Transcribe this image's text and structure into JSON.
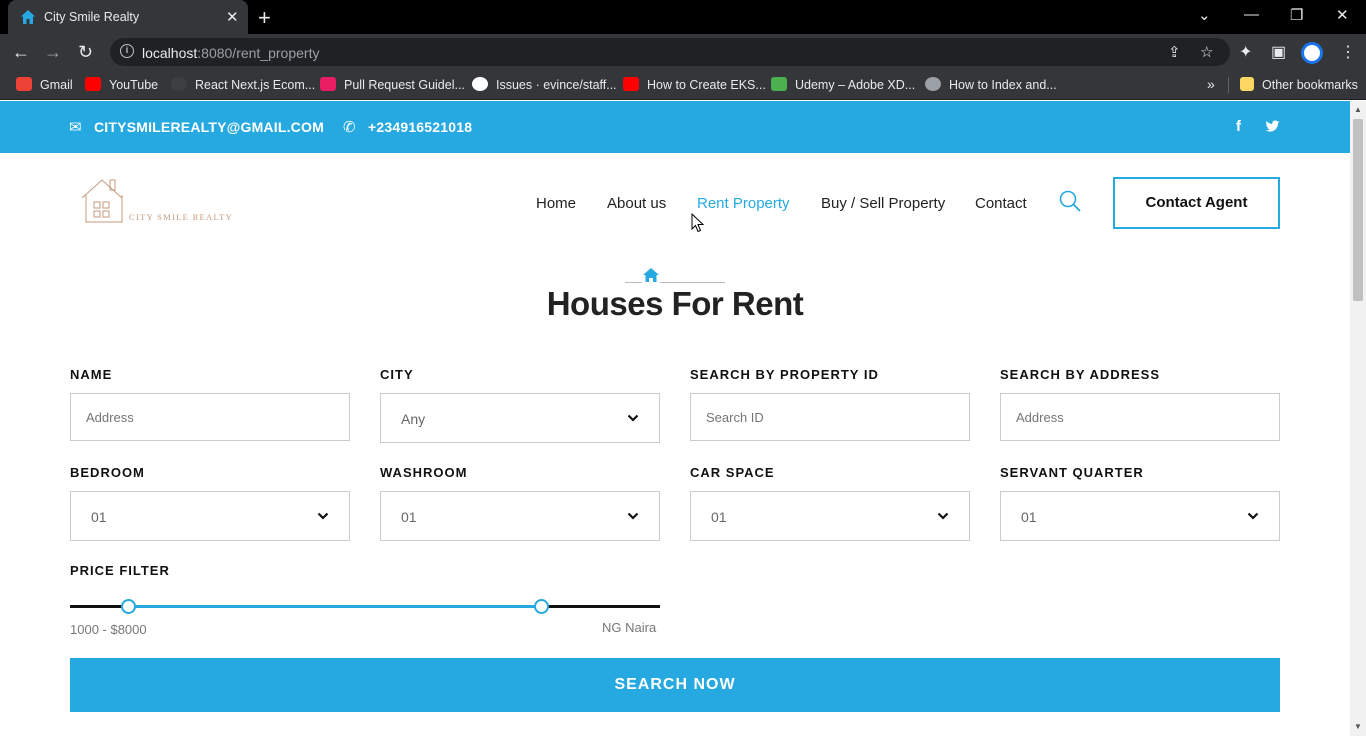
{
  "browser": {
    "tab_title": "City Smile Realty",
    "url_host": "localhost",
    "url_rest": ":8080/rent_property",
    "bookmarks": [
      {
        "label": "Gmail",
        "color": "#ea4335"
      },
      {
        "label": "YouTube",
        "color": "#ff0000"
      },
      {
        "label": "React Next.js Ecom...",
        "color": "#3c4043"
      },
      {
        "label": "Pull Request Guidel...",
        "color": "#e91e63"
      },
      {
        "label": "Issues · evince/staff...",
        "color": "#ffffff"
      },
      {
        "label": "How to Create EKS...",
        "color": "#ff0000"
      },
      {
        "label": "Udemy – Adobe XD...",
        "color": "#4caf50"
      },
      {
        "label": "How to Index and...",
        "color": "#9aa0a6"
      }
    ],
    "other_bookmarks": "Other bookmarks"
  },
  "topbar": {
    "email": "CITYSMILEREALTY@GMAIL.COM",
    "phone": "+234916521018",
    "social": [
      "facebook-icon",
      "twitter-icon"
    ]
  },
  "header": {
    "logo_text": "CITY SMILE REALTY",
    "nav": [
      {
        "label": "Home",
        "active": false
      },
      {
        "label": "About us",
        "active": false
      },
      {
        "label": "Rent Property",
        "active": true
      },
      {
        "label": "Buy / Sell Property",
        "active": false
      },
      {
        "label": "Contact",
        "active": false
      }
    ],
    "cta": "Contact Agent"
  },
  "page": {
    "title": "Houses For Rent"
  },
  "form": {
    "name": {
      "label": "NAME",
      "placeholder": "Address"
    },
    "city": {
      "label": "CITY",
      "value": "Any"
    },
    "property_id": {
      "label": "SEARCH BY PROPERTY ID",
      "placeholder": "Search ID"
    },
    "address": {
      "label": "SEARCH BY ADDRESS",
      "placeholder": "Address"
    },
    "bedroom": {
      "label": "BEDROOM",
      "value": "01"
    },
    "washroom": {
      "label": "WASHROOM",
      "value": "01"
    },
    "car_space": {
      "label": "CAR SPACE",
      "value": "01"
    },
    "servant_quarter": {
      "label": "SERVANT QUARTER",
      "value": "01"
    },
    "price": {
      "label": "PRICE FILTER",
      "range_text": "1000 - $8000",
      "currency": "NG Naira",
      "low_fraction": 0.098,
      "high_fraction": 0.798
    },
    "submit": "SEARCH NOW"
  },
  "colors": {
    "accent": "#26a9e0",
    "logo": "#c49a7c"
  }
}
